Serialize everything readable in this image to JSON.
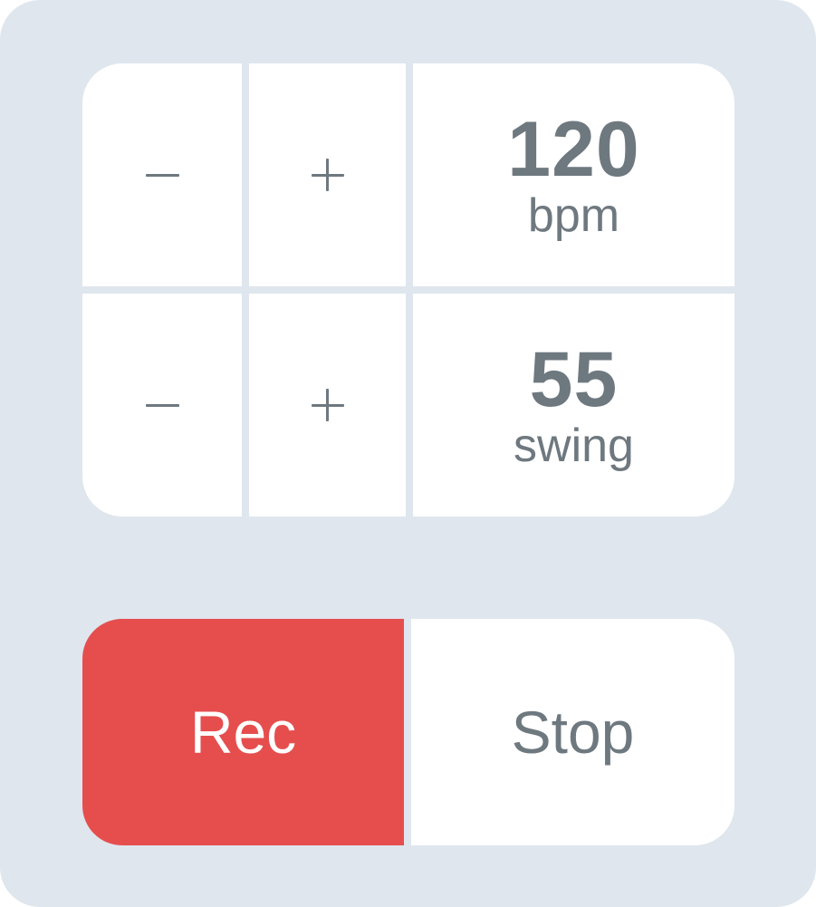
{
  "tempo": {
    "decrement_label": "–",
    "increment_label": "+",
    "value": "120",
    "unit": "bpm"
  },
  "swing": {
    "decrement_label": "–",
    "increment_label": "+",
    "value": "55",
    "unit": "swing"
  },
  "transport": {
    "rec_label": "Rec",
    "stop_label": "Stop"
  },
  "colors": {
    "panel_background": "#dfe6ee",
    "button_background": "#ffffff",
    "text": "#6e787f",
    "record": "#e64e4e"
  },
  "icons": {
    "decrement": "minus-icon",
    "increment": "plus-icon"
  }
}
